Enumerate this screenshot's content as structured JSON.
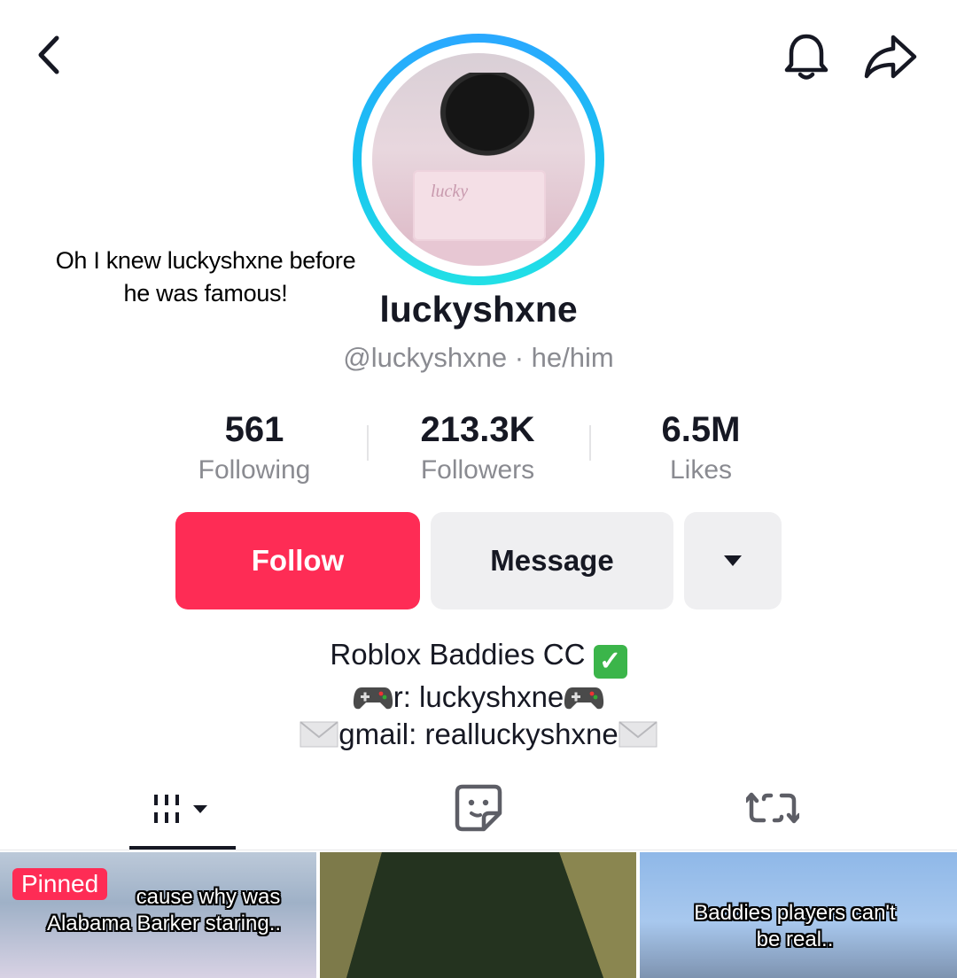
{
  "header": {
    "back_icon": "chevron-left-icon",
    "bell_icon": "bell-icon",
    "share_icon": "share-arrow-icon"
  },
  "avatar": {
    "ring_colors": [
      "#2aa8ff",
      "#22e0e6"
    ]
  },
  "overlay_caption": {
    "line1": "Oh I knew luckyshxne before",
    "line2": "he was famous!"
  },
  "profile": {
    "display_name": "luckyshxne",
    "username_line": "@luckyshxne · he/him"
  },
  "stats": {
    "following_count": "561",
    "following_label": "Following",
    "followers_count": "213.3K",
    "followers_label": "Followers",
    "likes_count": "6.5M",
    "likes_label": "Likes"
  },
  "actions": {
    "follow_label": "Follow",
    "message_label": "Message",
    "more_icon": "caret-down-icon",
    "accent_color": "#fe2c55"
  },
  "bio": {
    "line1": "Roblox Baddies CC",
    "line2": "r: luckyshxne",
    "line3": "gmail: realluckyshxne"
  },
  "tabs": {
    "videos_icon": "grid-videos-icon",
    "stickers_icon": "sticker-icon",
    "reposts_icon": "repost-icon"
  },
  "videos": [
    {
      "badge": "Pinned",
      "text_line1": "cause why was",
      "text_line2": "Alabama Barker staring.."
    },
    {},
    {
      "text_line1": "Baddies players can't",
      "text_line2": "be real.."
    }
  ]
}
